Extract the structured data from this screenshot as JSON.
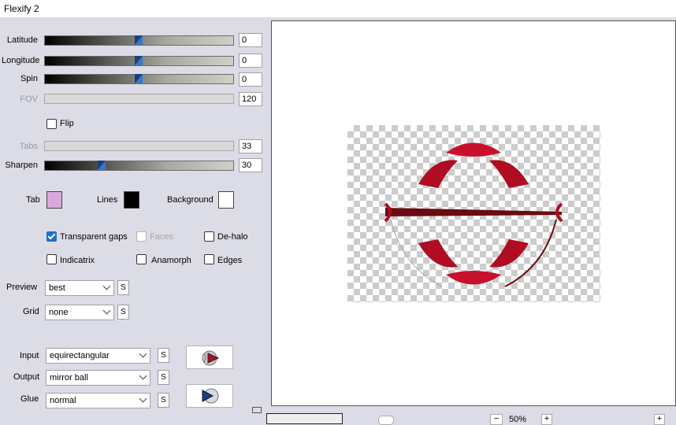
{
  "window": {
    "title": "Flexify 2"
  },
  "sliders": [
    {
      "label": "Latitude",
      "value": "0",
      "enabled": true,
      "level": 0.5
    },
    {
      "label": "Longitude",
      "value": "0",
      "enabled": true,
      "level": 0.5
    },
    {
      "label": "Spin",
      "value": "0",
      "enabled": true,
      "level": 0.5
    },
    {
      "label": "FOV",
      "value": "120",
      "enabled": false
    },
    {
      "label": "Tabs",
      "value": "33",
      "enabled": false
    },
    {
      "label": "Sharpen",
      "value": "30",
      "enabled": true,
      "level": 0.3
    }
  ],
  "flip": {
    "label": "Flip",
    "checked": false
  },
  "colors": {
    "tab": {
      "label": "Tab",
      "color": "#d9a9dc"
    },
    "lines": {
      "label": "Lines",
      "color": "#000000"
    },
    "background": {
      "label": "Background",
      "color": "#ffffff"
    }
  },
  "options": [
    {
      "label": "Transparent gaps",
      "checked": true,
      "enabled": true
    },
    {
      "label": "Faces",
      "checked": false,
      "enabled": false
    },
    {
      "label": "De-halo",
      "checked": false,
      "enabled": true
    },
    {
      "label": "Indicatrix",
      "checked": false,
      "enabled": true
    },
    {
      "label": "Anamorph",
      "checked": false,
      "enabled": true
    },
    {
      "label": "Edges",
      "checked": false,
      "enabled": true
    }
  ],
  "preview": {
    "label": "Preview",
    "value": "best"
  },
  "grid": {
    "label": "Grid",
    "value": "none"
  },
  "input": {
    "label": "Input",
    "value": "equirectangular"
  },
  "output": {
    "label": "Output",
    "value": "mirror ball"
  },
  "glue": {
    "label": "Glue",
    "value": "normal"
  },
  "s_label": "S",
  "zoom": {
    "value": "50%"
  },
  "accent": "#1e6fd0",
  "art_color": "#d0102a"
}
